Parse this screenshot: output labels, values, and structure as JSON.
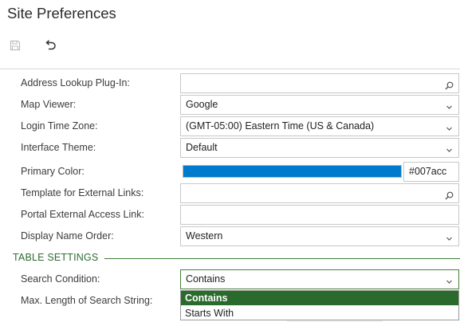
{
  "page": {
    "title": "Site Preferences"
  },
  "toolbar": {
    "save_icon": "save-icon",
    "undo_icon": "undo-icon"
  },
  "fields": {
    "address_lookup": {
      "label": "Address Lookup Plug-In:",
      "value": "",
      "icon": "search-icon"
    },
    "map_viewer": {
      "label": "Map Viewer:",
      "value": "Google",
      "icon": "chevron-down-icon"
    },
    "login_time_zone": {
      "label": "Login Time Zone:",
      "value": "(GMT-05:00) Eastern Time (US & Canada)",
      "icon": "chevron-down-icon"
    },
    "interface_theme": {
      "label": "Interface Theme:",
      "value": "Default",
      "icon": "chevron-down-icon"
    },
    "primary_color": {
      "label": "Primary Color:",
      "value": "#007acc",
      "swatch": "#007acc"
    },
    "template_external_links": {
      "label": "Template for External Links:",
      "value": "",
      "icon": "search-icon"
    },
    "portal_external_access": {
      "label": "Portal External Access Link:",
      "value": ""
    },
    "display_name_order": {
      "label": "Display Name Order:",
      "value": "Western",
      "icon": "chevron-down-icon"
    }
  },
  "table_settings": {
    "heading": "TABLE SETTINGS",
    "search_condition": {
      "label": "Search Condition:",
      "value": "Contains",
      "icon": "chevron-down-icon"
    },
    "max_length": {
      "label": "Max. Length of Search String:"
    },
    "dropdown_options": [
      "Contains",
      "Starts With"
    ]
  },
  "colors": {
    "accent": "#2a6a2c",
    "section": "#2e6b32",
    "primary_swatch": "#007acc"
  }
}
